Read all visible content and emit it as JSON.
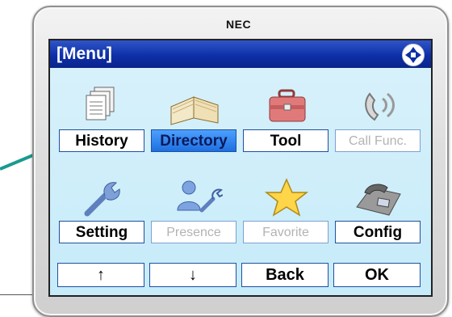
{
  "brand": "NEC",
  "header": {
    "title": "[Menu]",
    "nav_icon": "four-way-navigation-icon"
  },
  "menu_items": [
    {
      "label": "History",
      "icon": "history-icon",
      "state": "enabled"
    },
    {
      "label": "Directory",
      "icon": "directory-book-icon",
      "state": "selected"
    },
    {
      "label": "Tool",
      "icon": "toolbox-icon",
      "state": "enabled"
    },
    {
      "label": "Call Func.",
      "icon": "phone-call-icon",
      "state": "disabled"
    },
    {
      "label": "Setting",
      "icon": "wrench-icon",
      "state": "enabled"
    },
    {
      "label": "Presence",
      "icon": "presence-users-icon",
      "state": "disabled"
    },
    {
      "label": "Favorite",
      "icon": "star-icon",
      "state": "disabled"
    },
    {
      "label": "Config",
      "icon": "desk-phone-icon",
      "state": "enabled"
    }
  ],
  "softkeys": [
    {
      "label": "↑"
    },
    {
      "label": "↓"
    },
    {
      "label": "Back"
    },
    {
      "label": "OK"
    }
  ],
  "colors": {
    "title_bar": "#0d2fa8",
    "body_bg": "#c6ebf9",
    "selected": "#1d6fe0",
    "disabled_text": "#b3b3b3",
    "arrow": "#1a9b8f"
  }
}
